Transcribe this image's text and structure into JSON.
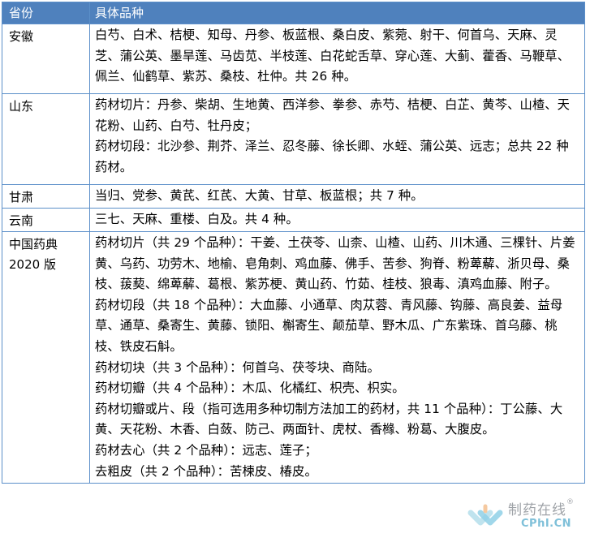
{
  "table": {
    "headers": [
      "省份",
      "具体品种"
    ],
    "rows": [
      {
        "province": "安徽",
        "lines": [
          "白芍、白术、桔梗、知母、丹参、板蓝根、桑白皮、紫菀、射干、何首乌、天麻、灵芝、蒲公英、墨旱莲、马齿苋、半枝莲、白花蛇舌草、穿心莲、大蓟、藿香、马鞭草、佩兰、仙鹤草、紫苏、桑枝、杜仲。共 26 种。"
        ]
      },
      {
        "province": "山东",
        "lines": [
          "药材切片：丹参、柴胡、生地黄、西洋参、拳参、赤芍、桔梗、白芷、黄芩、山楂、天花粉、山药、白芍、牡丹皮；",
          "药材切段：北沙参、荆芥、泽兰、忍冬藤、徐长卿、水蛭、蒲公英、远志；总共 22 种药材。"
        ]
      },
      {
        "province": "甘肃",
        "lines": [
          "当归、党参、黄芪、红芪、大黄、甘草、板蓝根；共 7 种。"
        ]
      },
      {
        "province": "云南",
        "lines": [
          "三七、天麻、重楼、白及。共 4 种。"
        ]
      },
      {
        "province": "中国药典 2020 版",
        "lines": [
          "药材切片（共 29 个品种）：干姜、土茯苓、山柰、山楂、山药、川木通、三棵针、片姜黄、乌药、功劳木、地榆、皂角刺、鸡血藤、佛手、苦参、狗脊、粉萆薢、浙贝母、桑枝、菝葜、绵萆薢、葛根、紫苏梗、黄山药、竹茹、桂枝、狼毒、滇鸡血藤、附子。",
          "药材切段（共 18 个品种）：大血藤、小通草、肉苁蓉、青风藤、钩藤、高良姜、益母草、通草、桑寄生、黄藤、锁阳、槲寄生、颠茄草、野木瓜、广东紫珠、首乌藤、桃枝、铁皮石斛。",
          "药材切块（共 3 个品种）：何首乌、茯苓块、商陆。",
          "药材切瓣（共 4 个品种）：木瓜、化橘红、枳壳、枳实。",
          "药材切瓣或片、段（指可选用多种切制方法加工的药材，共 11 个品种）：丁公藤、大黄、天花粉、木香、白蔹、防己、两面针、虎杖、香橼、粉葛、大腹皮。",
          "药材去心（共 2 个品种）：远志、莲子；",
          "去粗皮（共 2 个品种）：苦楝皮、椿皮。"
        ]
      }
    ]
  },
  "watermark": {
    "name": "制药在线",
    "reg": "®",
    "domain": "CPhI.CN"
  }
}
